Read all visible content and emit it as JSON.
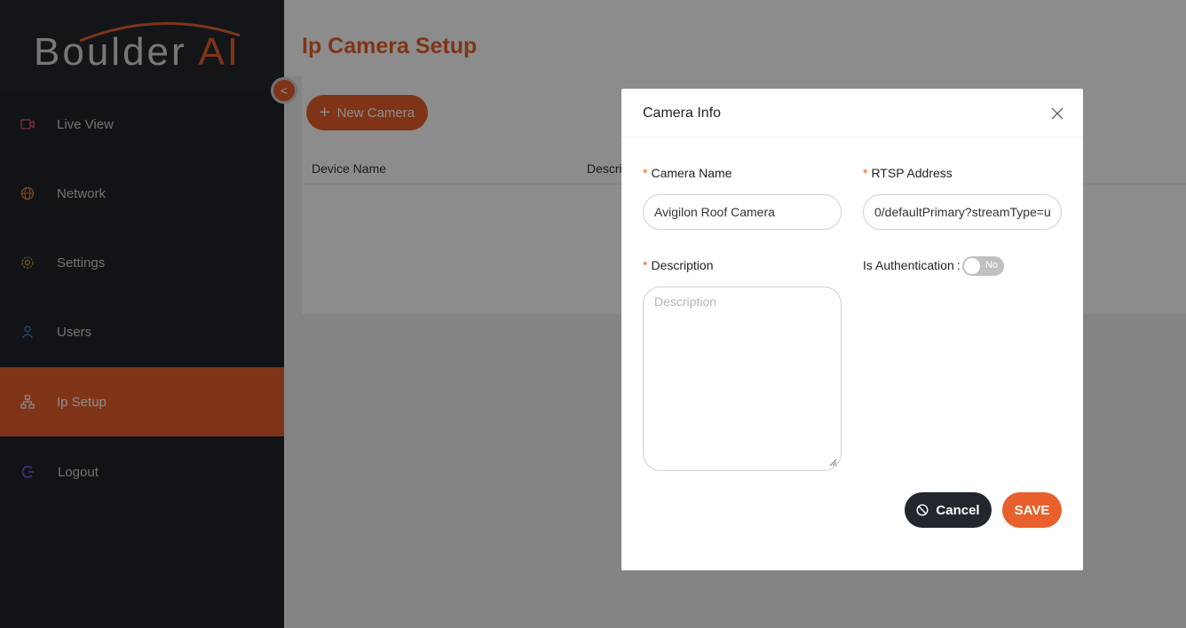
{
  "brand": {
    "word": "Boulder",
    "ai": "AI"
  },
  "sidebar": {
    "items": [
      {
        "label": "Live View",
        "icon": "video-camera-icon",
        "color": "#e85a6e"
      },
      {
        "label": "Network",
        "icon": "globe-icon",
        "color": "#e8823c"
      },
      {
        "label": "Settings",
        "icon": "gear-icon",
        "color": "#c9a23a"
      },
      {
        "label": "Users",
        "icon": "user-icon",
        "color": "#3a8fe8"
      },
      {
        "label": "Ip Setup",
        "icon": "network-tree-icon",
        "color": "#e8602c"
      },
      {
        "label": "Logout",
        "icon": "logout-icon",
        "color": "#8b5cf6"
      }
    ],
    "active": "Ip Setup",
    "collapse_glyph": "<"
  },
  "page": {
    "title": "Ip Camera Setup",
    "new_camera_label": "New Camera",
    "table": {
      "columns": [
        "Device Name",
        "Descri"
      ]
    }
  },
  "modal": {
    "title": "Camera Info",
    "camera_name_label": "Camera Name",
    "camera_name_value": "Avigilon Roof Camera",
    "rtsp_label": "RTSP Address",
    "rtsp_value": "0/defaultPrimary?streamType=u",
    "description_label": "Description",
    "description_placeholder": "Description",
    "auth_label": "Is Authentication",
    "auth_colon": ":",
    "auth_toggle": "No",
    "required_mark": "*",
    "cancel_label": "Cancel",
    "save_label": "SAVE"
  },
  "colors": {
    "accent": "#e8602c",
    "sidebar_bg": "#1f2329",
    "dark_button": "#22262d"
  }
}
